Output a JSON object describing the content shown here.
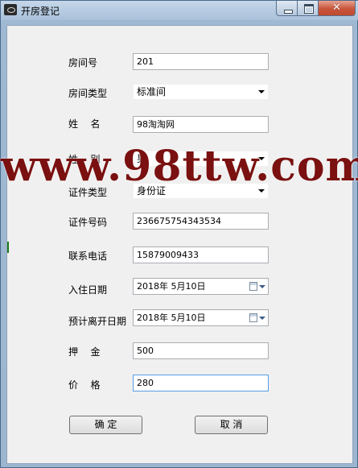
{
  "window": {
    "title": "开房登记"
  },
  "form": {
    "room_no": {
      "label": "房间号",
      "value": "201"
    },
    "room_type": {
      "label": "房间类型",
      "value": "标准间"
    },
    "name": {
      "label": "姓  名",
      "value": "98淘淘网"
    },
    "gender": {
      "label": "姓  别",
      "value": "男"
    },
    "id_type": {
      "label": "证件类型",
      "value": "身份证"
    },
    "id_no": {
      "label": "证件号码",
      "value": "236675754343534"
    },
    "phone": {
      "label": "联系电话",
      "value": "15879009433"
    },
    "checkin_date": {
      "label": "入住日期",
      "value": "2018年 5月10日"
    },
    "checkout_date": {
      "label": "预计离开日期",
      "value": "2018年 5月10日"
    },
    "deposit": {
      "label": "押  金",
      "value": "500"
    },
    "price": {
      "label": "价  格",
      "value": "280"
    }
  },
  "buttons": {
    "confirm": "确  定",
    "cancel": "取  消"
  },
  "watermark": "www.98ttw.com"
}
